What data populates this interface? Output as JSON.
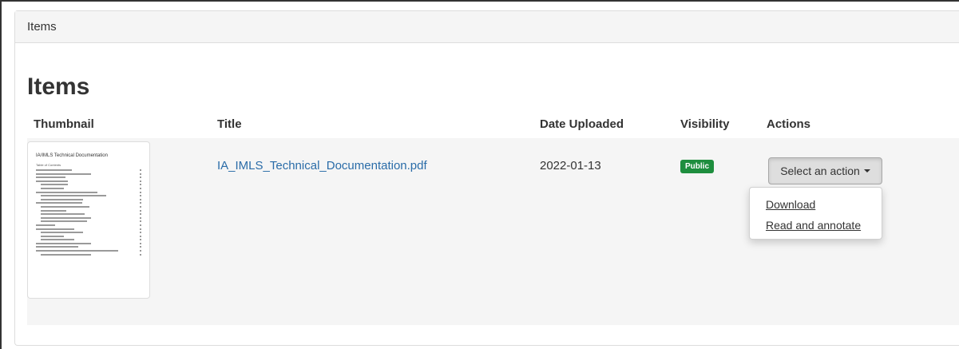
{
  "breadcrumb": {
    "label": "Items"
  },
  "page": {
    "title": "Items"
  },
  "table": {
    "headers": {
      "thumbnail": "Thumbnail",
      "title": "Title",
      "date_uploaded": "Date Uploaded",
      "visibility": "Visibility",
      "actions": "Actions"
    },
    "rows": [
      {
        "thumbnail": {
          "doc_title": "IA/IMLS Technical Documentation",
          "doc_subtitle": "Table of Contents"
        },
        "title": "IA_IMLS_Technical_Documentation.pdf",
        "date_uploaded": "2022-01-13",
        "visibility": "Public",
        "action_button": "Select an action",
        "action_menu": [
          "Download",
          "Read and annotate"
        ]
      }
    ]
  },
  "colors": {
    "link": "#2a6ca8",
    "badge_public": "#1e8e3e",
    "panel_heading": "#f5f5f5"
  },
  "icons": {
    "dropdown_caret": "caret-down-icon"
  }
}
